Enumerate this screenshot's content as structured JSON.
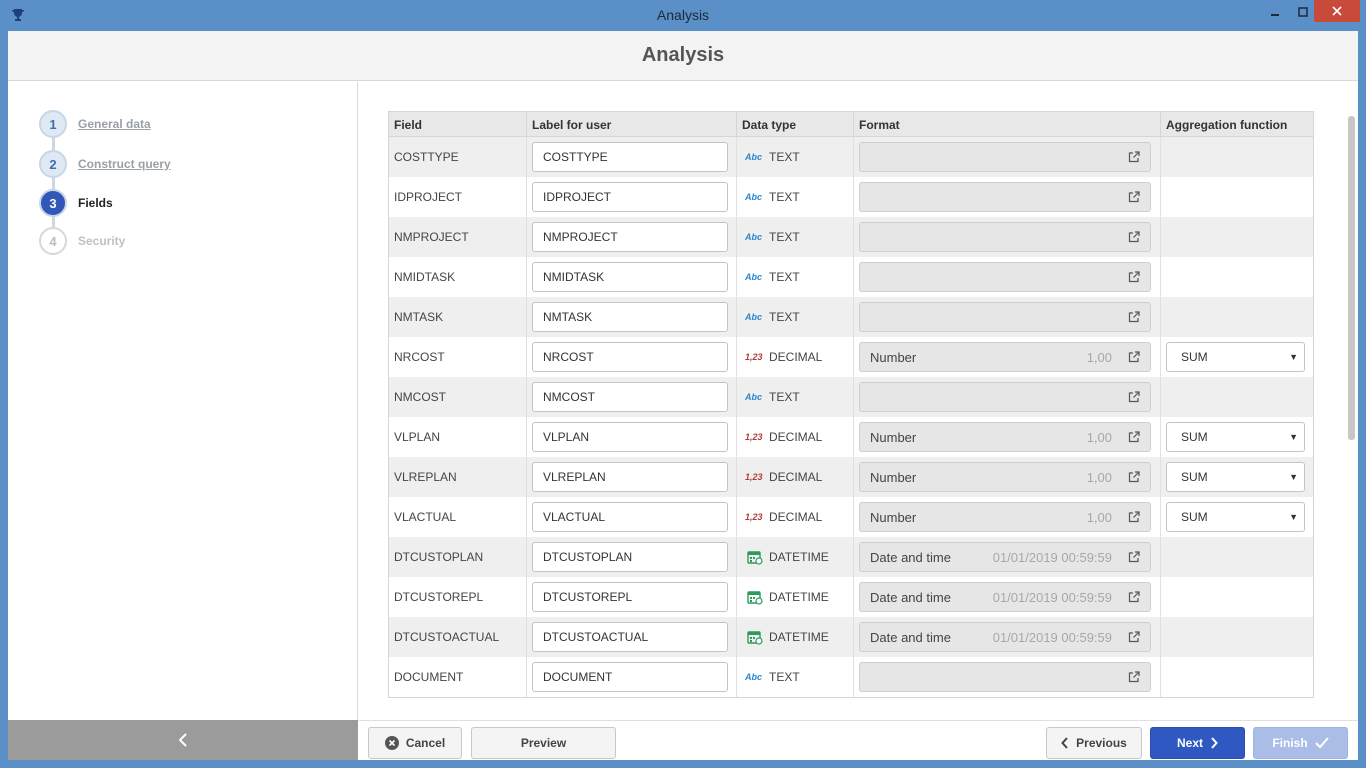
{
  "window": {
    "title": "Analysis"
  },
  "header": {
    "title": "Analysis"
  },
  "steps": [
    {
      "num": "1",
      "label": "General data",
      "state": "done"
    },
    {
      "num": "2",
      "label": "Construct query",
      "state": "done"
    },
    {
      "num": "3",
      "label": "Fields",
      "state": "active"
    },
    {
      "num": "4",
      "label": "Security",
      "state": "pending"
    }
  ],
  "table": {
    "headers": [
      "Field",
      "Label for user",
      "Data type",
      "Format",
      "Aggregation function"
    ],
    "rows": [
      {
        "field": "COSTTYPE",
        "label": "COSTTYPE",
        "type": "TEXT",
        "icon": "text-type-icon",
        "format": "",
        "format_value": "",
        "agg": ""
      },
      {
        "field": "IDPROJECT",
        "label": "IDPROJECT",
        "type": "TEXT",
        "icon": "text-type-icon",
        "format": "",
        "format_value": "",
        "agg": ""
      },
      {
        "field": "NMPROJECT",
        "label": "NMPROJECT",
        "type": "TEXT",
        "icon": "text-type-icon",
        "format": "",
        "format_value": "",
        "agg": ""
      },
      {
        "field": "NMIDTASK",
        "label": "NMIDTASK",
        "type": "TEXT",
        "icon": "text-type-icon",
        "format": "",
        "format_value": "",
        "agg": ""
      },
      {
        "field": "NMTASK",
        "label": "NMTASK",
        "type": "TEXT",
        "icon": "text-type-icon",
        "format": "",
        "format_value": "",
        "agg": ""
      },
      {
        "field": "NRCOST",
        "label": "NRCOST",
        "type": "DECIMAL",
        "icon": "decimal-type-icon",
        "format": "Number",
        "format_value": "1,00",
        "agg": "SUM"
      },
      {
        "field": "NMCOST",
        "label": "NMCOST",
        "type": "TEXT",
        "icon": "text-type-icon",
        "format": "",
        "format_value": "",
        "agg": ""
      },
      {
        "field": "VLPLAN",
        "label": "VLPLAN",
        "type": "DECIMAL",
        "icon": "decimal-type-icon",
        "format": "Number",
        "format_value": "1,00",
        "agg": "SUM"
      },
      {
        "field": "VLREPLAN",
        "label": "VLREPLAN",
        "type": "DECIMAL",
        "icon": "decimal-type-icon",
        "format": "Number",
        "format_value": "1,00",
        "agg": "SUM"
      },
      {
        "field": "VLACTUAL",
        "label": "VLACTUAL",
        "type": "DECIMAL",
        "icon": "decimal-type-icon",
        "format": "Number",
        "format_value": "1,00",
        "agg": "SUM"
      },
      {
        "field": "DTCUSTOPLAN",
        "label": "DTCUSTOPLAN",
        "type": "DATETIME",
        "icon": "calendar-type-icon",
        "format": "Date and time",
        "format_value": "01/01/2019 00:59:59",
        "agg": ""
      },
      {
        "field": "DTCUSTOREPL",
        "label": "DTCUSTOREPL",
        "type": "DATETIME",
        "icon": "calendar-type-icon",
        "format": "Date and time",
        "format_value": "01/01/2019 00:59:59",
        "agg": ""
      },
      {
        "field": "DTCUSTOACTUAL",
        "label": "DTCUSTOACTUAL",
        "type": "DATETIME",
        "icon": "calendar-type-icon",
        "format": "Date and time",
        "format_value": "01/01/2019 00:59:59",
        "agg": ""
      },
      {
        "field": "DOCUMENT",
        "label": "DOCUMENT",
        "type": "TEXT",
        "icon": "text-type-icon",
        "format": "",
        "format_value": "",
        "agg": ""
      }
    ]
  },
  "icons": {
    "text": "Abc",
    "decimal": "1,23"
  },
  "footer": {
    "cancel": "Cancel",
    "preview": "Preview",
    "previous": "Previous",
    "next": "Next",
    "finish": "Finish"
  },
  "colors": {
    "accent": "#2f58c2",
    "titlebar": "#5a8fc7",
    "close": "#c74a3a",
    "finish_disabled": "#a9bde6"
  }
}
